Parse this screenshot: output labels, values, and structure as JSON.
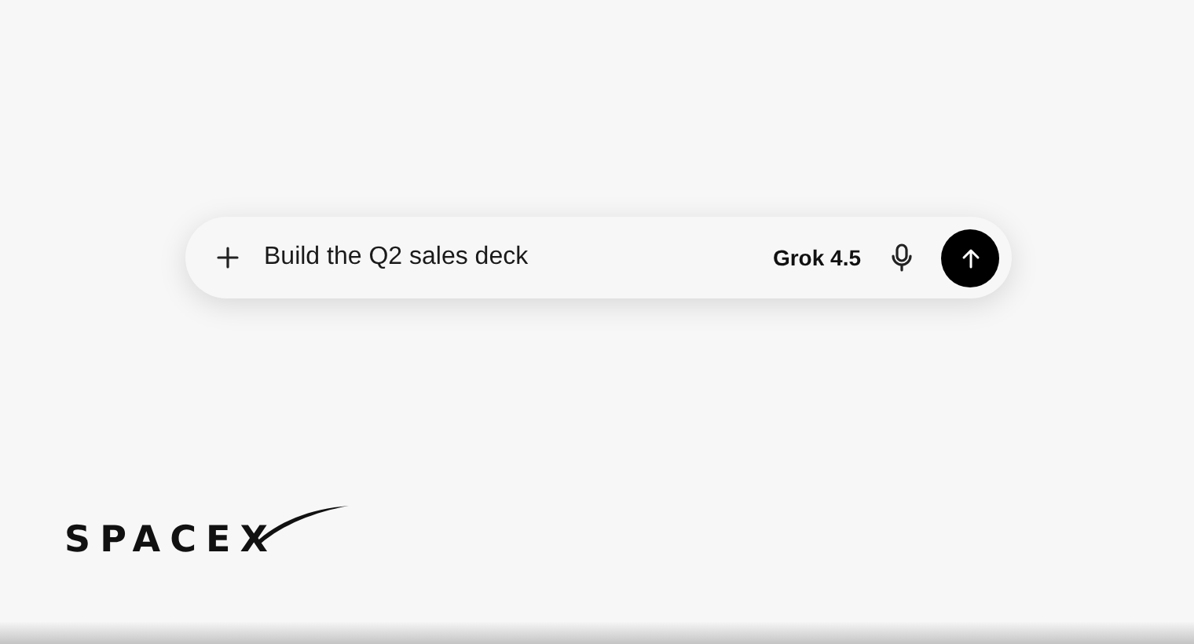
{
  "prompt_bar": {
    "value": "Build the Q2 sales deck",
    "model": "Grok 4.5"
  },
  "logo": {
    "text": "SPACEX"
  }
}
